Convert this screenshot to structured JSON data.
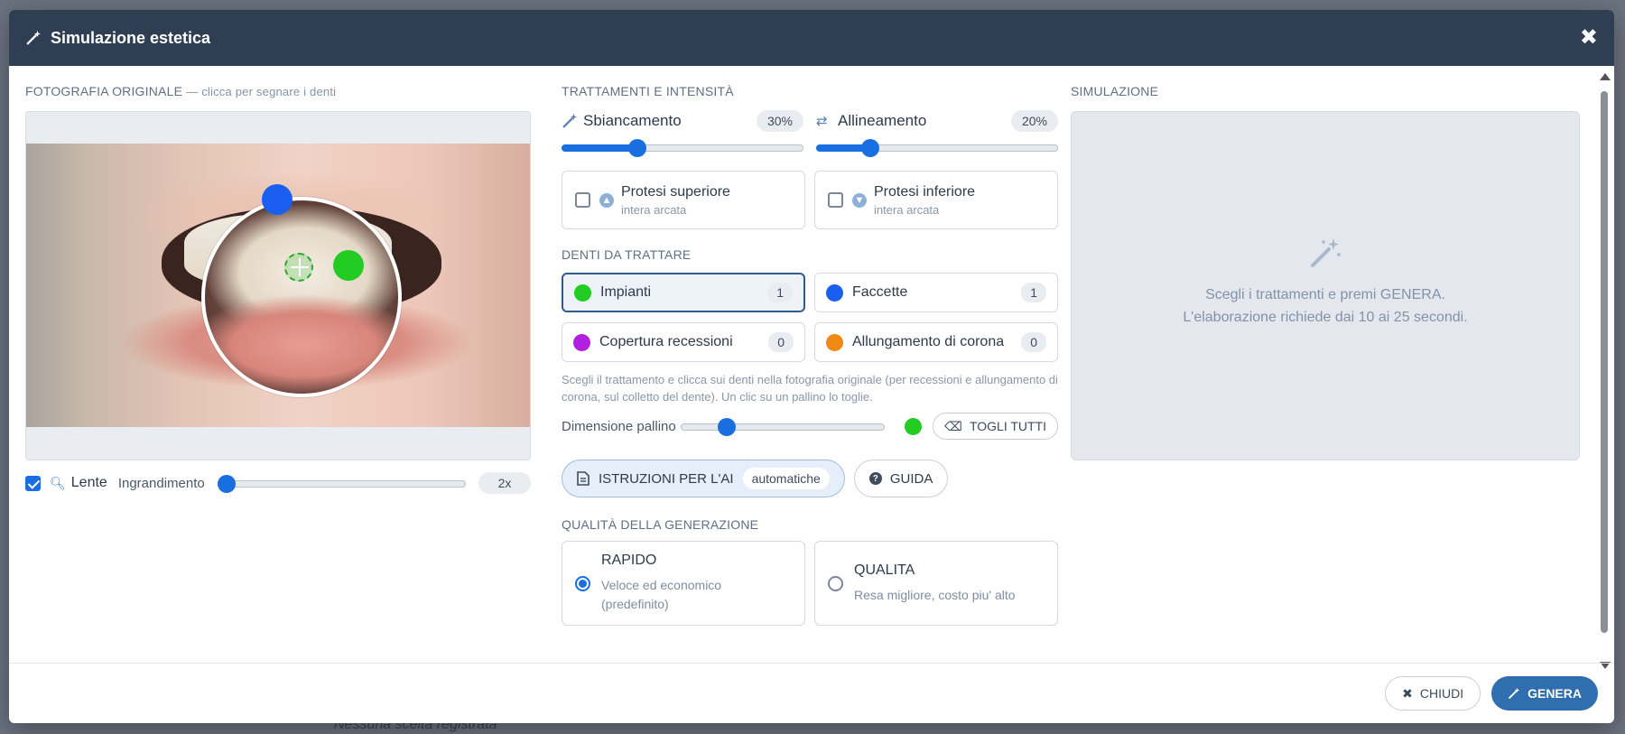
{
  "background": {
    "text": "Nessuna scelta registrata"
  },
  "modal": {
    "title": "Simulazione estetica",
    "close_icon": "close-icon",
    "header_icon": "magic-wand-icon"
  },
  "photo_section": {
    "label": "FOTOGRAFIA ORIGINALE",
    "sublabel": "— clicca per segnare i denti",
    "lens": {
      "checked": true,
      "label": "Lente",
      "zoom_label": "Ingrandimento",
      "zoom_value": "2x",
      "zoom_fraction": 0
    }
  },
  "treatments": {
    "label": "TRATTAMENTI E INTENSITÀ",
    "whitening": {
      "label": "Sbiancamento",
      "value": "30%",
      "fraction": 0.3,
      "icon": "magic-wand-icon"
    },
    "alignment": {
      "label": "Allineamento",
      "value": "20%",
      "fraction": 0.2,
      "icon": "swap-arrows-icon"
    },
    "upper_prosthesis": {
      "label": "Protesi superiore",
      "sub": "intera arcata",
      "checked": false,
      "icon": "arrow-up-circle-icon"
    },
    "lower_prosthesis": {
      "label": "Protesi inferiore",
      "sub": "intera arcata",
      "checked": false,
      "icon": "arrow-down-circle-icon"
    }
  },
  "teeth": {
    "label": "DENTI DA TRATTARE",
    "items": [
      {
        "name": "Impianti",
        "count": "1",
        "color": "#22cc22",
        "active": true
      },
      {
        "name": "Faccette",
        "count": "1",
        "color": "#1a5ff0",
        "active": false
      },
      {
        "name": "Copertura recessioni",
        "count": "0",
        "color": "#b020e0",
        "active": false
      },
      {
        "name": "Allungamento di corona",
        "count": "0",
        "color": "#f08a12",
        "active": false
      }
    ],
    "hint": "Scegli il trattamento e clicca sui denti nella fotografia originale (per recessioni e allungamento di corona, sul colletto del dente). Un clic su un pallino lo toglie.",
    "dot_size_label": "Dimensione pallino",
    "dot_size_fraction": 0.2,
    "remove_all": "TOGLI TUTTI"
  },
  "ai": {
    "instructions_label": "ISTRUZIONI PER L'AI",
    "instructions_mode": "automatiche",
    "guide_label": "GUIDA"
  },
  "quality": {
    "label": "QUALITÀ DELLA GENERAZIONE",
    "fast": {
      "title": "RAPIDO",
      "desc1": "Veloce ed economico",
      "desc2": "(predefinito)",
      "selected": true
    },
    "hq": {
      "title": "QUALITA",
      "desc": "Resa migliore, costo piu' alto",
      "selected": false
    }
  },
  "simulation": {
    "label": "SIMULAZIONE",
    "line1": "Scegli i trattamenti e premi GENERA.",
    "line2": "L'elaborazione richiede dai 10 ai 25 secondi."
  },
  "footer": {
    "close_label": "CHIUDI",
    "generate_label": "GENERA"
  },
  "colors": {
    "header": "#2f3e52",
    "accent": "#1a6fe0",
    "generate": "#2f6fb0"
  }
}
